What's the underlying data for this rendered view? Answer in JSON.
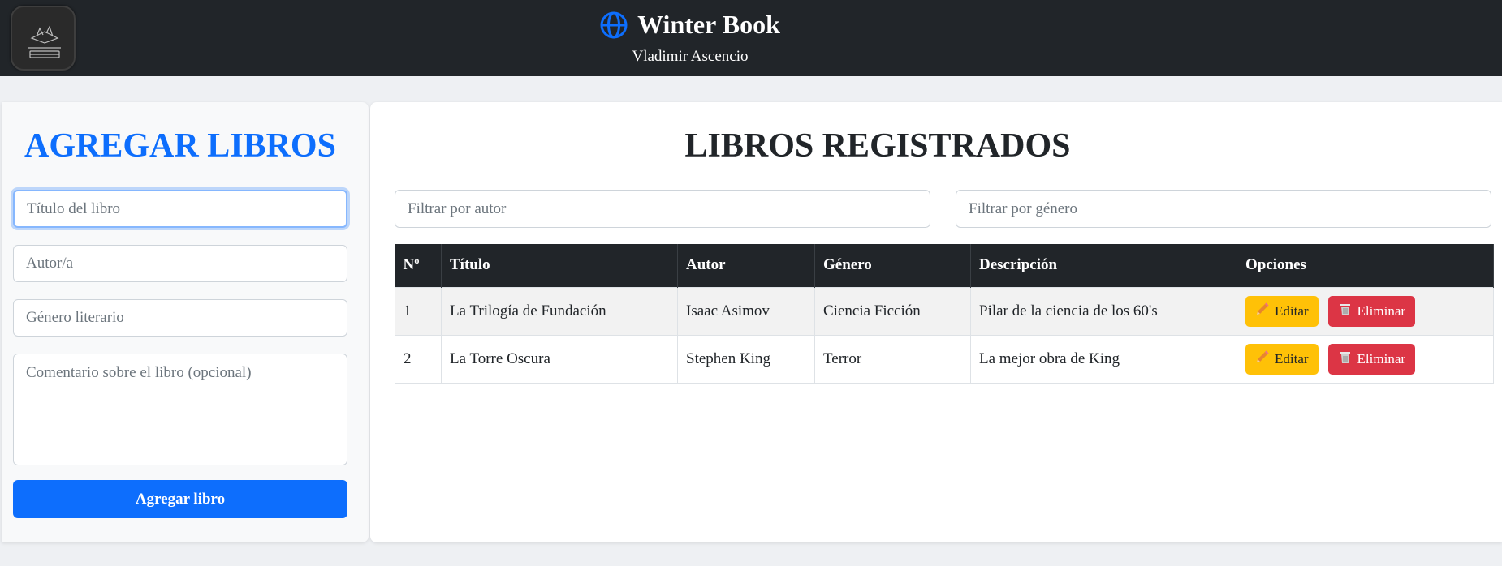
{
  "header": {
    "brand_title": "Winter Book",
    "subtitle": "Vladimir Ascencio",
    "brand_icon": "globe-icon",
    "colors": {
      "background": "#212529",
      "icon": "#0d6efd",
      "text": "#ffffff"
    }
  },
  "form": {
    "title": "AGREGAR LIBROS",
    "title_placeholder": "Título del libro",
    "author_placeholder": "Autor/a",
    "genre_placeholder": "Género literario",
    "comment_placeholder": "Comentario sobre el libro (opcional)",
    "submit_label": "Agregar libro",
    "colors": {
      "accent": "#0d6efd"
    }
  },
  "list": {
    "title": "LIBROS REGISTRADOS",
    "filter_author_placeholder": "Filtrar por autor",
    "filter_genre_placeholder": "Filtrar por género",
    "columns": [
      "Nº",
      "Título",
      "Autor",
      "Género",
      "Descripción",
      "Opciones"
    ],
    "rows": [
      {
        "num": "1",
        "title": "La Trilogía de Fundación",
        "author": "Isaac Asimov",
        "genre": "Ciencia Ficción",
        "description": "Pilar de la ciencia de los 60's",
        "edit_label": "Editar",
        "delete_label": "Eliminar"
      },
      {
        "num": "2",
        "title": "La Torre Oscura",
        "author": "Stephen King",
        "genre": "Terror",
        "description": "La mejor obra de King",
        "edit_label": "Editar",
        "delete_label": "Eliminar"
      }
    ],
    "colors": {
      "edit": "#ffc107",
      "delete": "#dc3545",
      "header": "#212529"
    }
  }
}
